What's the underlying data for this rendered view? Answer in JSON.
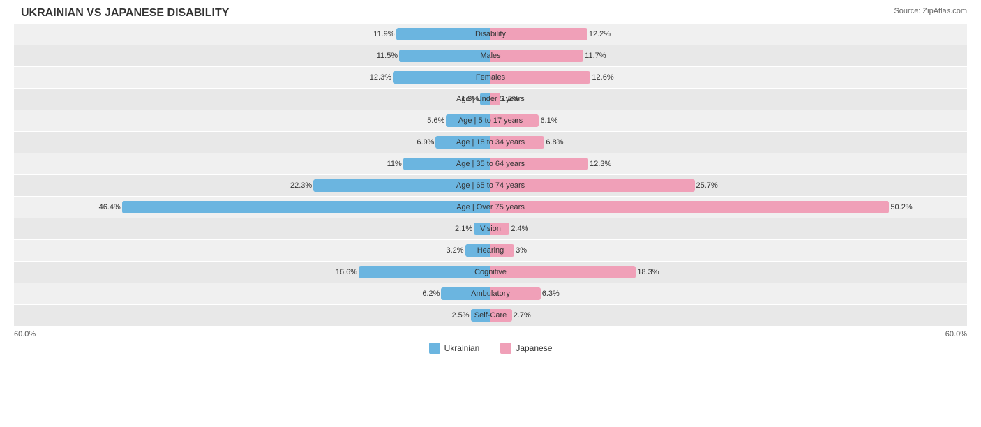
{
  "title": "UKRAINIAN VS JAPANESE DISABILITY",
  "source": "Source: ZipAtlas.com",
  "chart": {
    "maxPercent": 60,
    "rows": [
      {
        "label": "Disability",
        "ukrainian": 11.9,
        "japanese": 12.2
      },
      {
        "label": "Males",
        "ukrainian": 11.5,
        "japanese": 11.7
      },
      {
        "label": "Females",
        "ukrainian": 12.3,
        "japanese": 12.6
      },
      {
        "label": "Age | Under 5 years",
        "ukrainian": 1.3,
        "japanese": 1.2
      },
      {
        "label": "Age | 5 to 17 years",
        "ukrainian": 5.6,
        "japanese": 6.1
      },
      {
        "label": "Age | 18 to 34 years",
        "ukrainian": 6.9,
        "japanese": 6.8
      },
      {
        "label": "Age | 35 to 64 years",
        "ukrainian": 11.0,
        "japanese": 12.3
      },
      {
        "label": "Age | 65 to 74 years",
        "ukrainian": 22.3,
        "japanese": 25.7
      },
      {
        "label": "Age | Over 75 years",
        "ukrainian": 46.4,
        "japanese": 50.2
      },
      {
        "label": "Vision",
        "ukrainian": 2.1,
        "japanese": 2.4
      },
      {
        "label": "Hearing",
        "ukrainian": 3.2,
        "japanese": 3.0
      },
      {
        "label": "Cognitive",
        "ukrainian": 16.6,
        "japanese": 18.3
      },
      {
        "label": "Ambulatory",
        "ukrainian": 6.2,
        "japanese": 6.3
      },
      {
        "label": "Self-Care",
        "ukrainian": 2.5,
        "japanese": 2.7
      }
    ]
  },
  "legend": {
    "ukrainian_label": "Ukrainian",
    "japanese_label": "Japanese",
    "ukrainian_color": "#6bb5e0",
    "japanese_color": "#f0a0b8"
  },
  "axis": {
    "left": "60.0%",
    "right": "60.0%"
  }
}
